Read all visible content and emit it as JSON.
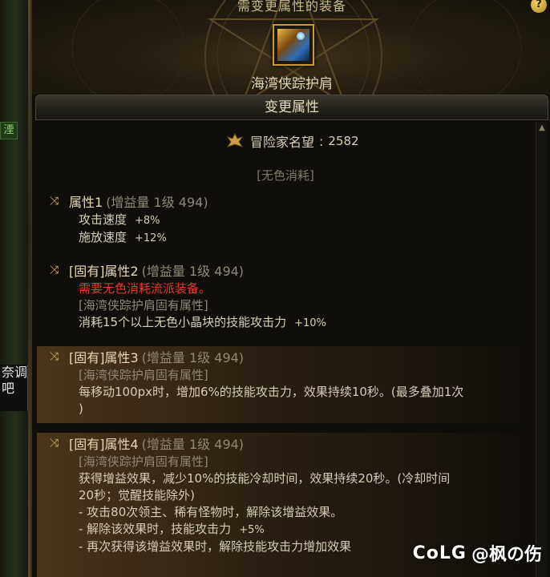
{
  "left_strip": {
    "chip_text": "湮",
    "shard_text": "奈调\n吧"
  },
  "top": {
    "title": "需变更属性的装备",
    "help_icon": "?",
    "item_name": "海湾侠踪护肩"
  },
  "section": {
    "title": "变更属性"
  },
  "fame": {
    "label": "冒险家名望",
    "sep": ":",
    "value": "2582"
  },
  "consume_tag": "[无色消耗]",
  "attributes": [
    {
      "title": "属性1",
      "meta": "(增益量 1级 494)",
      "lines": [
        {
          "text": "攻击速度",
          "value": "+8%",
          "style": "normal"
        },
        {
          "text": "施放速度",
          "value": "+12%",
          "style": "normal"
        }
      ]
    },
    {
      "title": "[固有]属性2",
      "meta": "(增益量 1级 494)",
      "lines": [
        {
          "text": "需要无色消耗流派装备。",
          "value": "",
          "style": "red"
        },
        {
          "text": "[海湾侠踪护肩固有属性]",
          "value": "",
          "style": "grey"
        },
        {
          "text": "消耗15个以上无色小晶块的技能攻击力",
          "value": "+10%",
          "style": "normal"
        }
      ]
    },
    {
      "title": "[固有]属性3",
      "meta": "(增益量 1级 494)",
      "lines": [
        {
          "text": "[海湾侠踪护肩固有属性]",
          "value": "",
          "style": "grey"
        },
        {
          "text": "每移动100px时，增加6%的技能攻击力，效果持续10秒。(最多叠加1次",
          "value": "",
          "style": "normal"
        },
        {
          "text": ")",
          "value": "",
          "style": "normal"
        }
      ]
    },
    {
      "title": "[固有]属性4",
      "meta": "(增益量 1级 494)",
      "lines": [
        {
          "text": "[海湾侠踪护肩固有属性]",
          "value": "",
          "style": "grey"
        },
        {
          "text": "获得增益效果，减少10%的技能冷却时间，效果持续20秒。(冷却时间",
          "value": "",
          "style": "normal"
        },
        {
          "text": "20秒；觉醒技能除外)",
          "value": "",
          "style": "normal"
        },
        {
          "text": "- 攻击80次领主、稀有怪物时，解除该增益效果。",
          "value": "",
          "style": "normal"
        },
        {
          "text": "- 解除该效果时，技能攻击力",
          "value": "+5%",
          "style": "normal"
        },
        {
          "text": "- 再次获得该增益效果时，解除技能攻击力增加效果",
          "value": "",
          "style": "normal"
        }
      ]
    }
  ],
  "watermark": {
    "logo": "CoLG",
    "text": "@枫の伤"
  },
  "colors": {
    "accent_gold": "#c79a36",
    "warning_red": "#e23a2a",
    "highlight_bar": "#785628"
  }
}
